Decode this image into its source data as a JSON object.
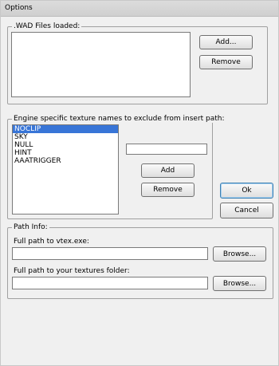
{
  "window": {
    "title": "Options"
  },
  "wad_group": {
    "legend": ".WAD Files loaded:",
    "add_label": "Add...",
    "remove_label": "Remove"
  },
  "texture_group": {
    "legend": "Engine specific texture names to exclude from insert path:",
    "items": [
      "NOCLIP",
      "SKY",
      "NULL",
      "HINT",
      "AAATRIGGER"
    ],
    "selected_index": 0,
    "input_value": "",
    "add_label": "Add",
    "remove_label": "Remove"
  },
  "dialog": {
    "ok_label": "Ok",
    "cancel_label": "Cancel"
  },
  "path_group": {
    "legend": "Path Info:",
    "vtex_label": "Full path to vtex.exe:",
    "vtex_value": "",
    "textures_label": "Full path to your textures folder:",
    "textures_value": "",
    "browse_label": "Browse..."
  },
  "colors": {
    "selection": "#3875d7",
    "window_bg": "#f0f0f0"
  }
}
